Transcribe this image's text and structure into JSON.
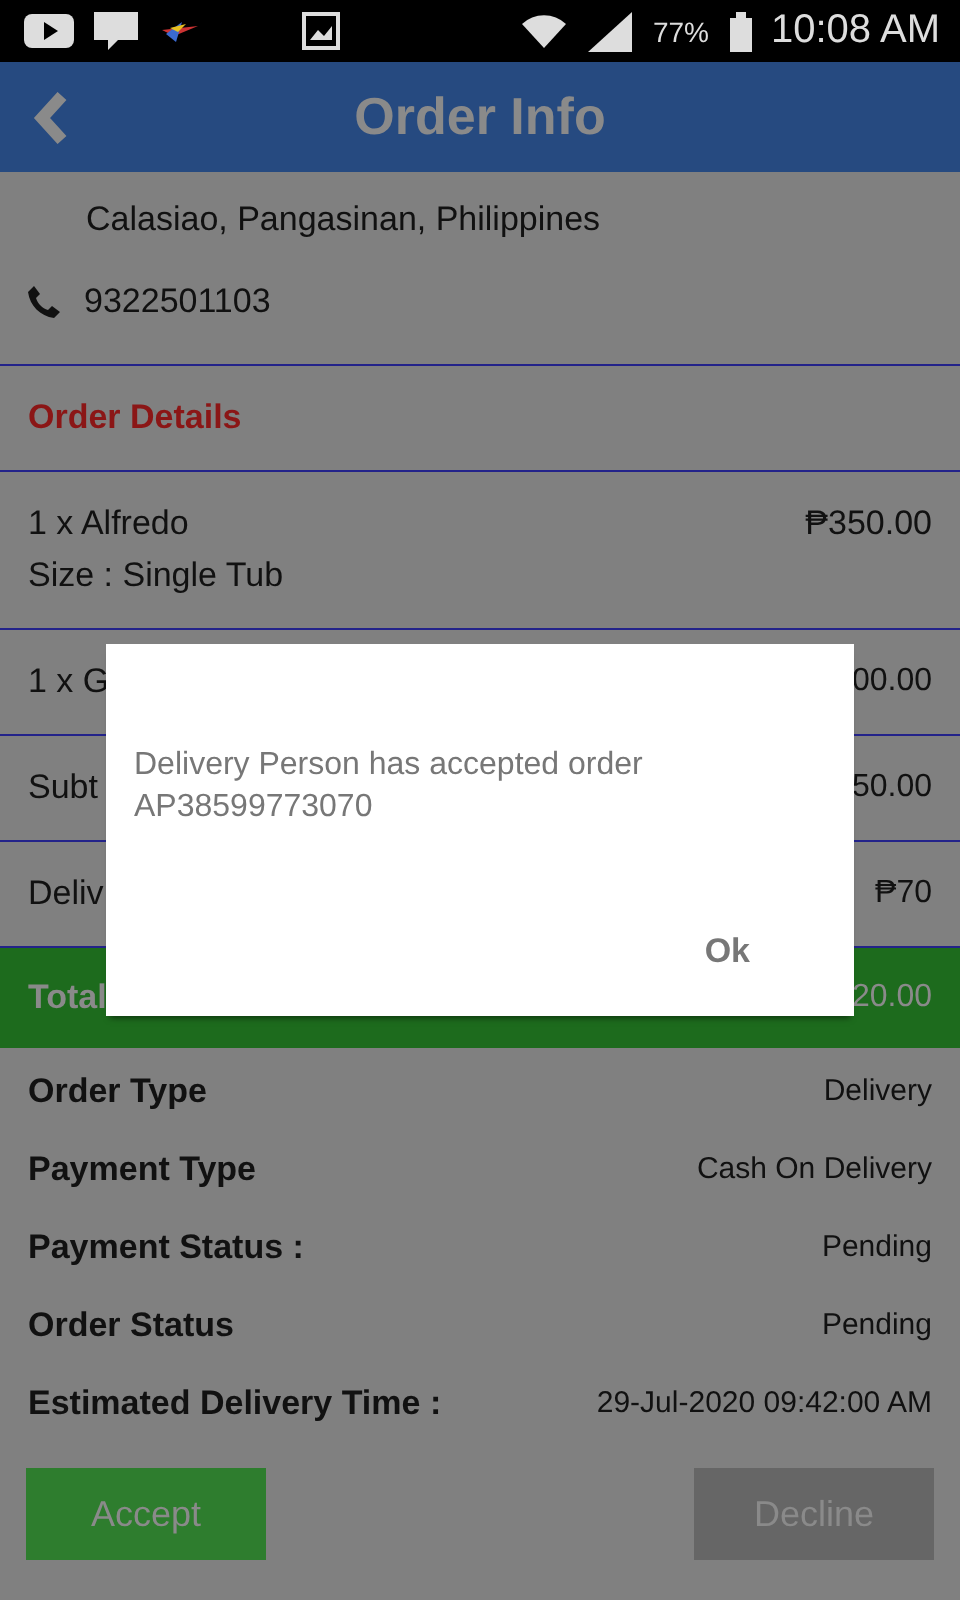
{
  "status_bar": {
    "battery": "77%",
    "time": "10:08 AM"
  },
  "header": {
    "title": "Order Info"
  },
  "address": "Calasiao, Pangasinan, Philippines",
  "phone": "9322501103",
  "order_details": {
    "heading": "Order Details",
    "lines": [
      {
        "kind": "item",
        "name": "1 x Alfredo",
        "price": "₱350.00",
        "option": "Size : Single Tub"
      },
      {
        "kind": "item",
        "name": "1 x G",
        "price": "00.00"
      },
      {
        "kind": "subtotal",
        "label": "Subt",
        "value": "50.00"
      },
      {
        "kind": "fee",
        "label": "Deliv",
        "value": "₱70"
      },
      {
        "kind": "total",
        "label": "Total",
        "value": "20.00"
      }
    ]
  },
  "info": [
    {
      "label": "Order Type",
      "value": "Delivery"
    },
    {
      "label": "Payment Type",
      "value": "Cash On Delivery"
    },
    {
      "label": "Payment Status :",
      "value": "Pending"
    },
    {
      "label": "Order Status",
      "value": "Pending"
    },
    {
      "label": "Estimated Delivery Time :",
      "value": "29-Jul-2020 09:42:00 AM"
    }
  ],
  "buttons": [
    {
      "kind": "accept",
      "label": "Accept"
    },
    {
      "kind": "decline",
      "label": "Decline"
    }
  ],
  "dialog": {
    "message": "Delivery Person has accepted order AP38599773070",
    "button": "Ok"
  }
}
